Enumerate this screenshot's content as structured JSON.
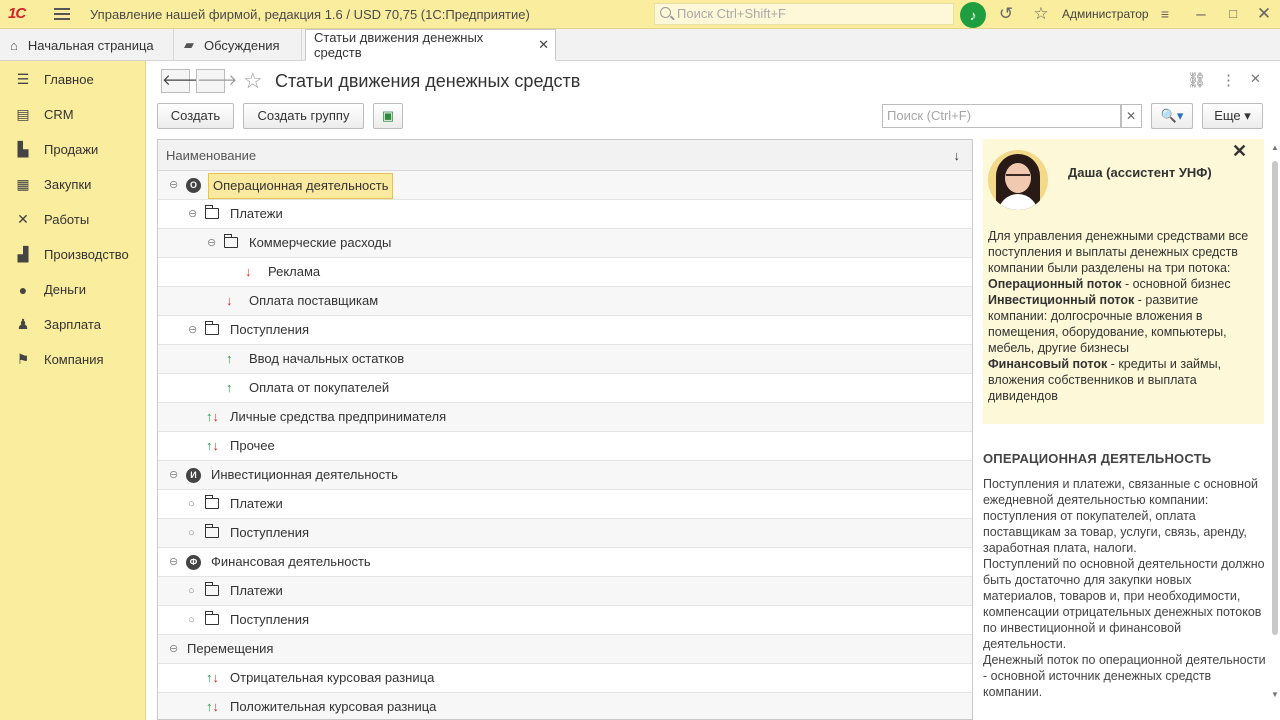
{
  "titlebar": {
    "logo": "1С",
    "title": "Управление нашей фирмой, редакция 1.6 / USD 70,75  (1С:Предприятие)",
    "search_placeholder": "Поиск Ctrl+Shift+F",
    "user": "Администратор"
  },
  "tabs": [
    {
      "label": "Начальная страница"
    },
    {
      "label": "Обсуждения"
    },
    {
      "label": "Статьи движения денежных средств"
    }
  ],
  "sidebar": {
    "items": [
      {
        "label": "Главное",
        "icon": "menu-icon"
      },
      {
        "label": "CRM",
        "icon": "crm-icon"
      },
      {
        "label": "Продажи",
        "icon": "cart-icon"
      },
      {
        "label": "Закупки",
        "icon": "purchases-icon"
      },
      {
        "label": "Работы",
        "icon": "tools-icon"
      },
      {
        "label": "Производство",
        "icon": "factory-icon"
      },
      {
        "label": "Деньги",
        "icon": "money-icon"
      },
      {
        "label": "Зарплата",
        "icon": "people-icon"
      },
      {
        "label": "Компания",
        "icon": "flag-icon"
      }
    ]
  },
  "form": {
    "title": "Статьи движения денежных средств",
    "create_label": "Создать",
    "create_group_label": "Создать группу",
    "search_placeholder": "Поиск (Ctrl+F)",
    "more_label": "Еще"
  },
  "table": {
    "header": "Наименование",
    "rows": [
      {
        "label": "Операционная деятельность"
      },
      {
        "label": "Платежи"
      },
      {
        "label": "Коммерческие расходы"
      },
      {
        "label": "Реклама"
      },
      {
        "label": "Оплата поставщикам"
      },
      {
        "label": "Поступления"
      },
      {
        "label": "Ввод начальных остатков"
      },
      {
        "label": "Оплата от покупателей"
      },
      {
        "label": "Личные средства предпринимателя"
      },
      {
        "label": "Прочее"
      },
      {
        "label": "Инвестиционная деятельность"
      },
      {
        "label": "Платежи"
      },
      {
        "label": "Поступления"
      },
      {
        "label": "Финансовая деятельность"
      },
      {
        "label": "Платежи"
      },
      {
        "label": "Поступления"
      },
      {
        "label": "Перемещения"
      },
      {
        "label": "Отрицательная курсовая разница"
      },
      {
        "label": "Положительная курсовая разница"
      }
    ],
    "badges": {
      "operational": "О",
      "investment": "И",
      "financial": "Ф"
    }
  },
  "assistant": {
    "name": "Даша (ассистент УНФ)",
    "intro": "Для управления денежными средствами все поступления и выплаты денежных средств компании были разделены на три потока:",
    "op_bold": "Операционный поток",
    "op_rest": " - основной бизнес",
    "inv_bold": "Инвестиционный поток",
    "inv_rest": " -  развитие компании: долгосрочные вложения в помещения, оборудование, компьютеры, мебель, другие бизнесы",
    "fin_bold": "Финансовый поток",
    "fin_rest": " -  кредиты и займы, вложения собственников и выплата дивидендов"
  },
  "description": {
    "heading": "ОПЕРАЦИОННАЯ ДЕЯТЕЛЬНОСТЬ",
    "p1": "Поступления и платежи, связанные с основной ежедневной деятельностью компании:",
    "p2": "поступления от покупателей, оплата поставщикам за товар, услуги, связь, аренду, заработная плата, налоги.",
    "p3": "Поступлений по основной деятельности должно быть достаточно для закупки новых материалов, товаров и, при необходимости, компенсации отрицательных денежных потоков по инвестиционной и финансовой деятельности.",
    "p4": "Денежный поток по операционной деятельности - основной источник денежных средств компании."
  }
}
